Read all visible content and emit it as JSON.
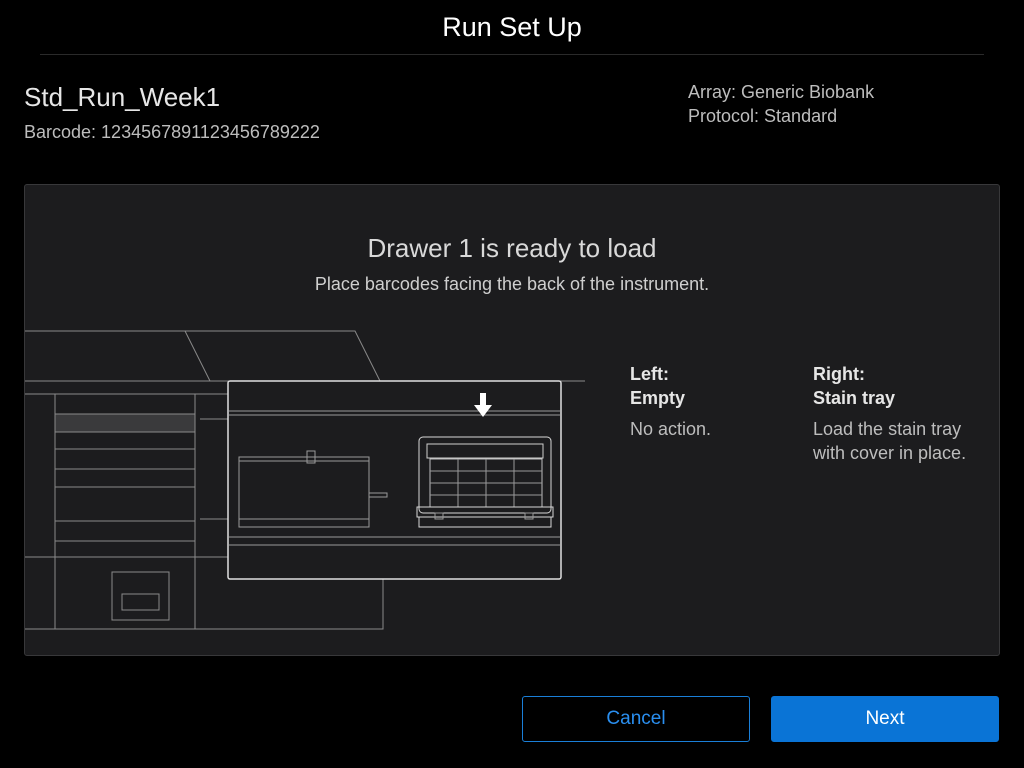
{
  "header": {
    "title": "Run Set Up"
  },
  "run": {
    "name": "Std_Run_Week1",
    "barcode": "Barcode: 1234567891123456789222",
    "array": "Array: Generic Biobank",
    "protocol": "Protocol: Standard"
  },
  "panel": {
    "heading": "Drawer 1 is ready to load",
    "subheading": "Place barcodes facing the back of the instrument.",
    "illustration_icon": "instrument-drawer-illustration",
    "left": {
      "label": "Left:",
      "value": "Empty",
      "action": "No action."
    },
    "right": {
      "label": "Right:",
      "value": "Stain tray",
      "action": "Load the stain tray with cover in place."
    }
  },
  "buttons": {
    "cancel_label": "Cancel",
    "next_label": "Next"
  },
  "colors": {
    "accent": "#0a74d6",
    "background": "#000000",
    "panel": "#1c1c1e"
  }
}
